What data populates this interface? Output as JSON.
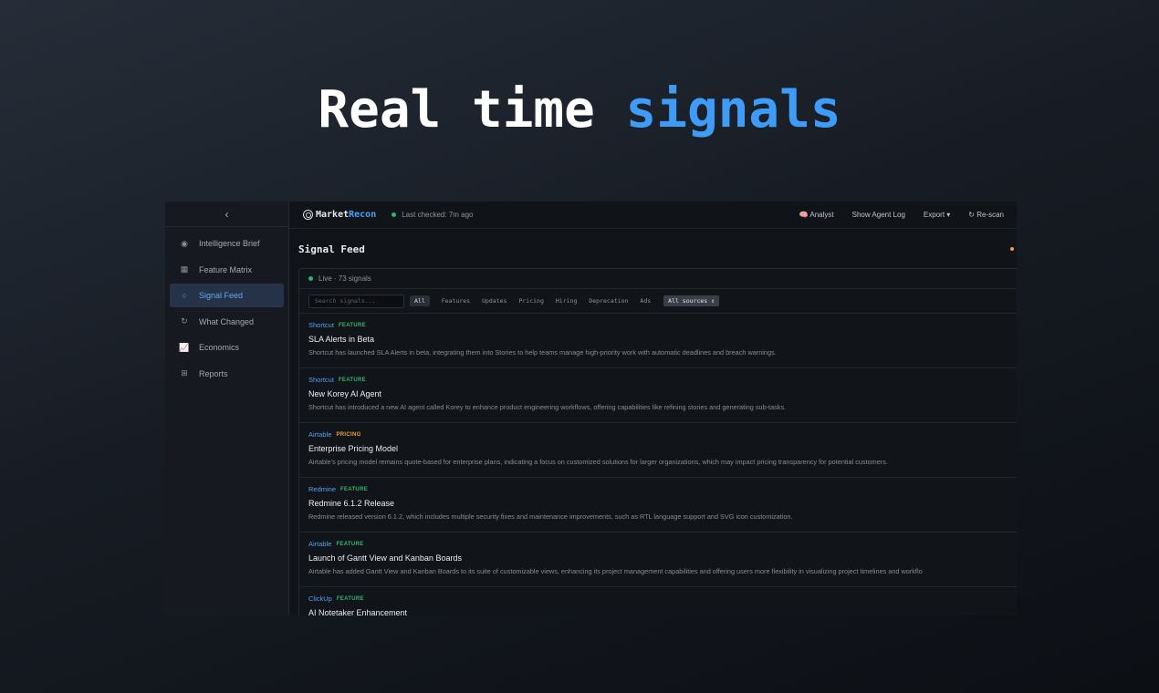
{
  "hero": {
    "text_plain": "Real time",
    "text_accent": "signals"
  },
  "colors": {
    "accent": "#3e9cf6",
    "feature_tag": "#38b46a",
    "pricing_tag": "#e4a23a",
    "live_dot": "#2fb561"
  },
  "sidebar": {
    "collapse_icon": "chevron-left-icon",
    "collapse_glyph": "‹",
    "items": [
      {
        "label": "Intelligence Brief",
        "icon": "target-icon",
        "glyph": "◉",
        "active": false
      },
      {
        "label": "Feature Matrix",
        "icon": "grid-icon",
        "glyph": "▦",
        "active": false
      },
      {
        "label": "Signal Feed",
        "icon": "circle-icon",
        "glyph": "○",
        "active": true
      },
      {
        "label": "What Changed",
        "icon": "refresh-icon",
        "glyph": "↻",
        "active": false
      },
      {
        "label": "Economics",
        "icon": "chart-icon",
        "glyph": "📈",
        "active": false
      },
      {
        "label": "Reports",
        "icon": "table-icon",
        "glyph": "⊞",
        "active": false
      }
    ]
  },
  "topbar": {
    "logo_a": "Market",
    "logo_b": "Recon",
    "last_checked": "Last checked: 7m ago",
    "analyst": "🧠 Analyst",
    "agent_log": "Show Agent Log",
    "export": "Export ▾",
    "rescan": "↻ Re-scan"
  },
  "feed": {
    "title": "Signal Feed",
    "live": "Live · 73 signals",
    "search_placeholder": "Search signals...",
    "filters": [
      "All",
      "Features",
      "Updates",
      "Pricing",
      "Hiring",
      "Deprecation",
      "Ads"
    ],
    "source_select": "All sources ⇕"
  },
  "signals": [
    {
      "company": "Shortcut",
      "tag": "FEATURE",
      "title": "SLA Alerts in Beta",
      "desc": "Shortcut has launched SLA Alerts in beta, integrating them into Stories to help teams manage high-priority work with automatic deadlines and breach warnings."
    },
    {
      "company": "Shortcut",
      "tag": "FEATURE",
      "title": "New Korey AI Agent",
      "desc": "Shortcut has introduced a new AI agent called Korey to enhance product engineering workflows, offering capabilities like refining stories and generating sub-tasks."
    },
    {
      "company": "Airtable",
      "tag": "PRICING",
      "title": "Enterprise Pricing Model",
      "desc": "Airtable's pricing model remains quote-based for enterprise plans, indicating a focus on customized solutions for larger organizations, which may impact pricing transparency for potential customers."
    },
    {
      "company": "Redmine",
      "tag": "FEATURE",
      "title": "Redmine 6.1.2 Release",
      "desc": "Redmine released version 6.1.2, which includes multiple security fixes and maintenance improvements, such as RTL language support and SVG icon customization."
    },
    {
      "company": "Airtable",
      "tag": "FEATURE",
      "title": "Launch of Gantt View and Kanban Boards",
      "desc": "Airtable has added Gantt View and Kanban Boards to its suite of customizable views, enhancing its project management capabilities and offering users more flexibility in visualizing project timelines and workflo"
    },
    {
      "company": "ClickUp",
      "tag": "FEATURE",
      "title": "AI Notetaker Enhancement",
      "desc": ""
    }
  ]
}
